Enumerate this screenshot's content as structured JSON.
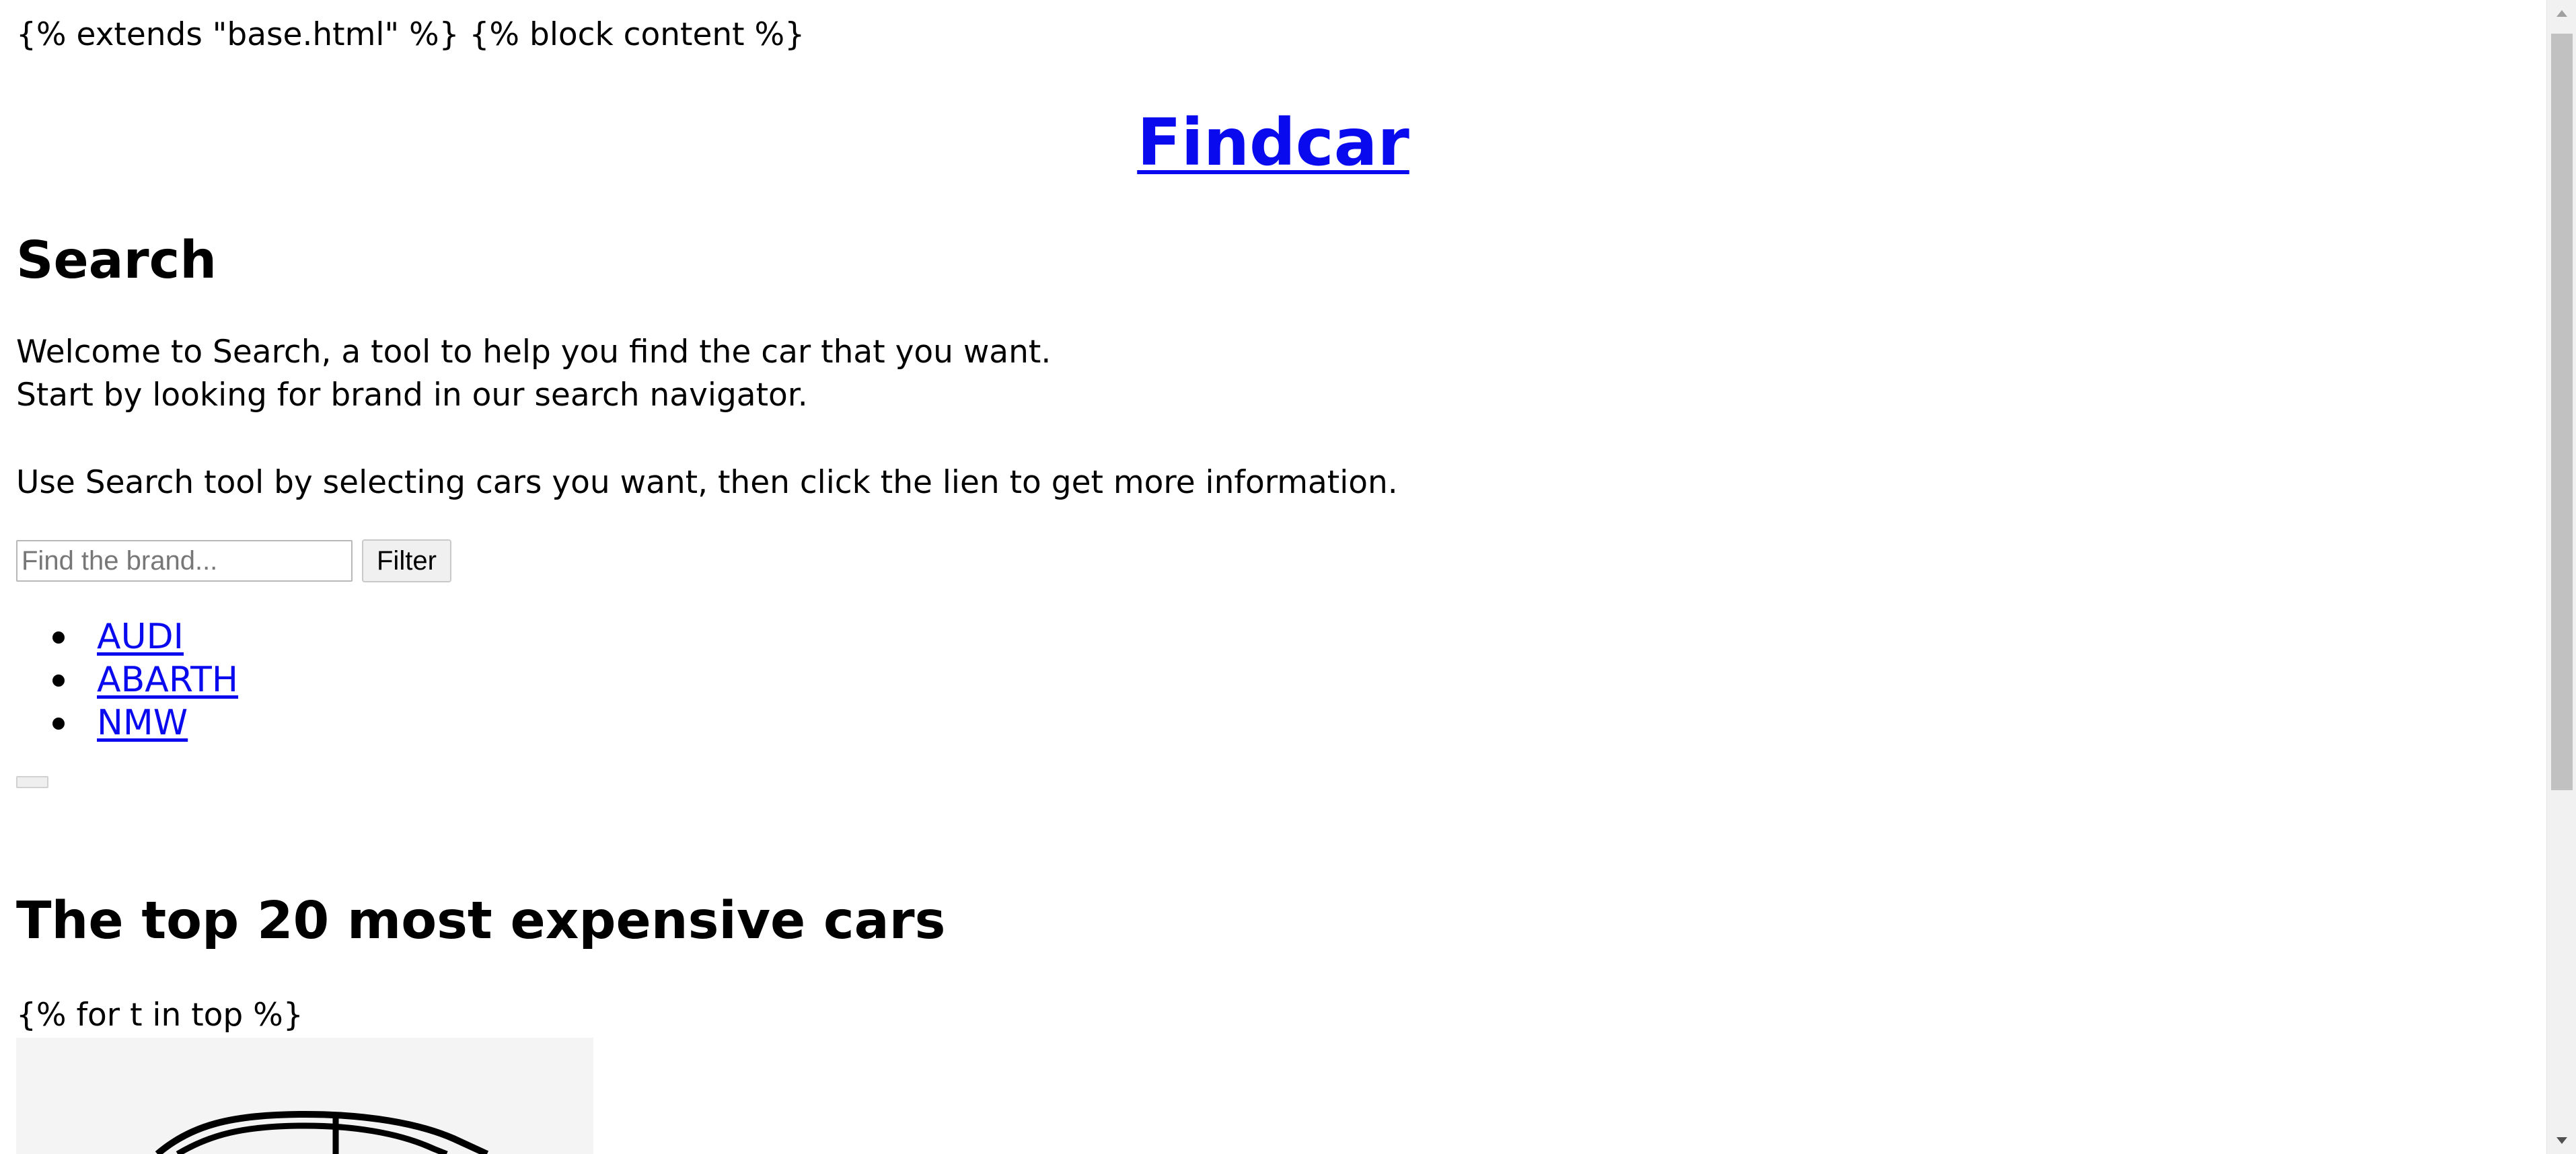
{
  "template": {
    "top_line": "{% extends \"base.html\" %} {% block content %}",
    "loop_line": "{% for t in top %}"
  },
  "site": {
    "title": "Findcar"
  },
  "search": {
    "heading": "Search",
    "intro_line_1": "Welcome to Search, a tool to help you find the car that you want.",
    "intro_line_2": "Start by looking for brand in our search navigator.",
    "usage": "Use Search tool by selecting cars you want, then click the lien to get more information.",
    "input_placeholder": "Find the brand...",
    "input_value": "",
    "filter_label": "Filter"
  },
  "brands": [
    {
      "label": "AUDI"
    },
    {
      "label": "ABARTH"
    },
    {
      "label": "NMW"
    }
  ],
  "top_section": {
    "heading": "The top 20 most expensive cars"
  },
  "image": {
    "icon": "car-icon",
    "background_color": "#f4f4f4"
  },
  "colors": {
    "link": "#0a0aee",
    "text": "#000000",
    "scrollbar_thumb": "#c1c1c1"
  }
}
